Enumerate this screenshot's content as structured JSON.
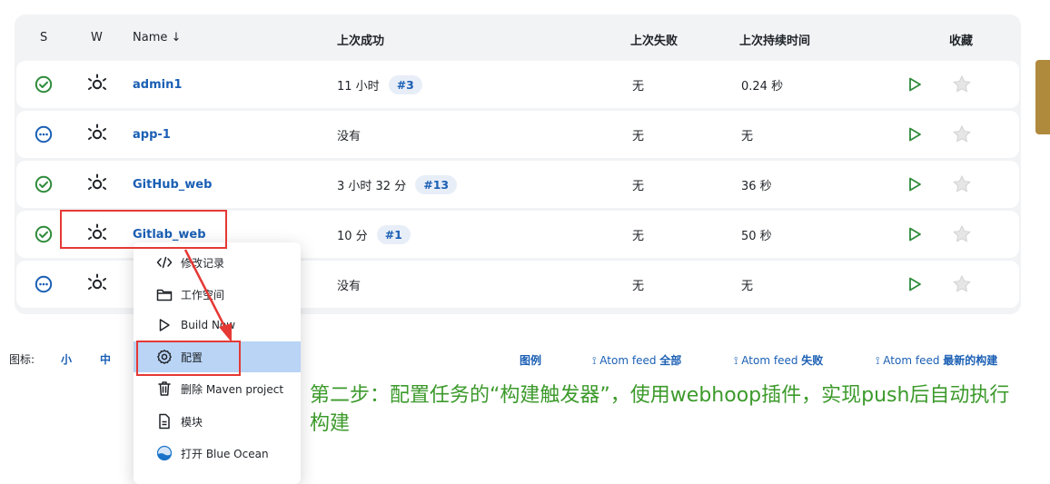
{
  "table": {
    "headers": {
      "s": "S",
      "w": "W",
      "name": "Name ↓",
      "last_success": "上次成功",
      "last_failure": "上次失败",
      "last_duration": "上次持续时间",
      "favorite": "收藏"
    },
    "rows": [
      {
        "status": "success",
        "name": "admin1",
        "last_success": "11 小时",
        "build": "#3",
        "last_failure": "无",
        "duration": "0.24 秒"
      },
      {
        "status": "not-built",
        "name": "app-1",
        "last_success": "没有",
        "build": "",
        "last_failure": "无",
        "duration": "无"
      },
      {
        "status": "success",
        "name": "GitHub_web",
        "last_success": "3 小时 32 分",
        "build": "#13",
        "last_failure": "无",
        "duration": "36 秒"
      },
      {
        "status": "success",
        "name": "Gitlab_web",
        "last_success": "10 分",
        "build": "#1",
        "last_failure": "无",
        "duration": "50 秒"
      },
      {
        "status": "not-built",
        "name": "",
        "last_success": "没有",
        "build": "",
        "last_failure": "无",
        "duration": "无"
      }
    ]
  },
  "bottom": {
    "icon_label": "图标:",
    "size_small": "小",
    "size_medium": "中",
    "legend": "图例",
    "feed_all_prefix": "Atom feed",
    "feed_all": "全部",
    "feed_fail_prefix": "Atom feed",
    "feed_fail": "失败",
    "feed_latest_prefix": "Atom feed",
    "feed_latest": "最新的构建"
  },
  "context_menu": {
    "items": [
      {
        "label": "修改记录",
        "icon": "code-icon"
      },
      {
        "label": "工作空间",
        "icon": "folder-icon"
      },
      {
        "label": "Build Now",
        "icon": "play-icon"
      },
      {
        "label": "配置",
        "icon": "gear-icon"
      },
      {
        "label": "删除 Maven project",
        "icon": "trash-icon"
      },
      {
        "label": "模块",
        "icon": "document-icon"
      },
      {
        "label": "打开 Blue Ocean",
        "icon": "blue-ocean-icon"
      }
    ]
  },
  "annotation": {
    "text": "第二步：配置任务的“构建触发器”，使用webhoop插件，实现push后自动执行构建"
  },
  "colors": {
    "success": "#2e8b3a",
    "not_built": "#1a5fb4",
    "link": "#1a5fb4",
    "annotation": "#3c9a2b",
    "highlight": "#e53935",
    "menu_active": "#b9d4f5"
  }
}
